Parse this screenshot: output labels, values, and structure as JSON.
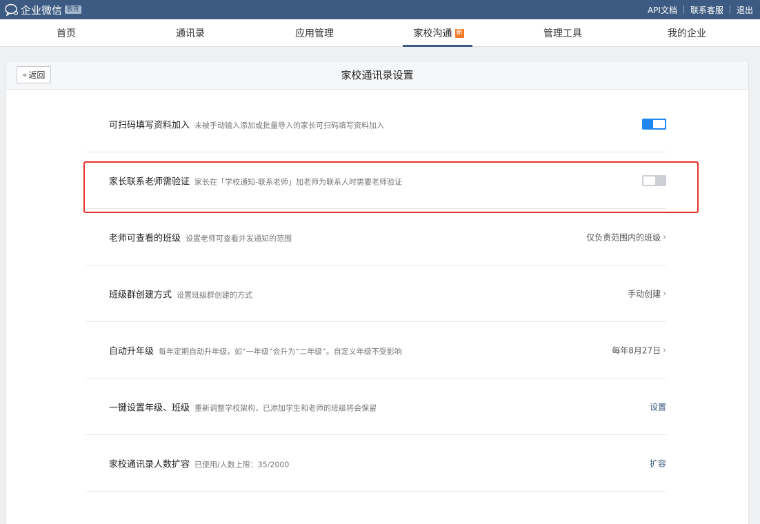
{
  "app": {
    "logo_text": "企业微信",
    "logo_badge": "教育"
  },
  "toplinks": [
    "API文档",
    "联系客服",
    "退出"
  ],
  "nav": {
    "items": [
      {
        "label": "首页"
      },
      {
        "label": "通讯录"
      },
      {
        "label": "应用管理"
      },
      {
        "label": "家校沟通",
        "badge": "新",
        "active": true
      },
      {
        "label": "管理工具"
      },
      {
        "label": "我的企业"
      }
    ]
  },
  "panel": {
    "back_label": "返回",
    "title": "家校通讯录设置"
  },
  "settings": [
    {
      "title": "可扫码填写资料加入",
      "desc": "未被手动输入添加或批量导入的家长可扫码填写资料加入",
      "control": "toggle",
      "on": true
    },
    {
      "title": "家长联系老师需验证",
      "desc": "家长在「学校通知-联系老师」加老师为联系人时需要老师验证",
      "control": "toggle",
      "on": false,
      "highlighted": true
    },
    {
      "title": "老师可查看的班级",
      "desc": "设置老师可查看并发通知的范围",
      "control": "select",
      "value": "仅负责范围内的班级"
    },
    {
      "title": "班级群创建方式",
      "desc": "设置班级群创建的方式",
      "control": "select",
      "value": "手动创建"
    },
    {
      "title": "自动升年级",
      "desc": "每年定期自动升年级，如“一年级”会升为“二年级”。自定义年级不受影响",
      "control": "select",
      "value": "每年8月27日"
    },
    {
      "title": "一键设置年级、班级",
      "desc": "重新调整学校架构，已添加学生和老师的班级将会保留",
      "control": "link",
      "value": "设置"
    },
    {
      "title": "家校通讯录人数扩容",
      "desc": "已使用/人数上限：35/2000",
      "control": "link",
      "value": "扩容"
    }
  ],
  "colors": {
    "topbar": "#3d5b82",
    "toggle_on": "#1f86f0",
    "toggle_off": "#ccd0d6",
    "highlight": "#e8332c",
    "new_badge": "#f57a29"
  }
}
